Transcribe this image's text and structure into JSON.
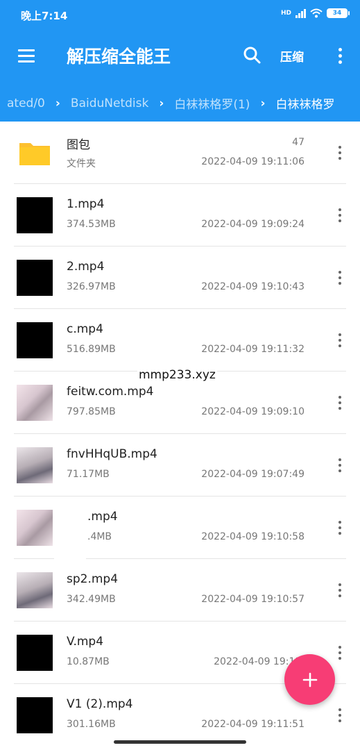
{
  "status_bar": {
    "time": "晚上7:14",
    "network": "HD",
    "battery": "34"
  },
  "toolbar": {
    "title": "解压缩全能王",
    "compress_label": "压缩",
    "menu_icon": "hamburger-menu-icon",
    "search_icon": "search-icon",
    "more_icon": "more-vert-icon"
  },
  "breadcrumb": [
    "ated/0",
    "BaiduNetdisk",
    "白袜袜格罗(1)",
    "白袜袜格罗"
  ],
  "files": [
    {
      "name": "图包",
      "sub": "文件夹",
      "count": "47",
      "date": "2022-04-09 19:11:06",
      "type": "folder"
    },
    {
      "name": "1.mp4",
      "sub": "374.53MB",
      "date": "2022-04-09 19:09:24",
      "type": "video"
    },
    {
      "name": "2.mp4",
      "sub": "326.97MB",
      "date": "2022-04-09 19:10:43",
      "type": "video"
    },
    {
      "name": "c.mp4",
      "sub": "516.89MB",
      "date": "2022-04-09 19:11:32",
      "type": "video"
    },
    {
      "name": "feitw.com.mp4",
      "sub": "797.85MB",
      "date": "2022-04-09 19:09:10",
      "type": "video"
    },
    {
      "name": "fnvHHqUB.mp4",
      "sub": "71.17MB",
      "date": "2022-04-09 19:07:49",
      "type": "video"
    },
    {
      "name": ".mp4",
      "sub": ".4MB",
      "date": "2022-04-09 19:10:58",
      "type": "video"
    },
    {
      "name": "sp2.mp4",
      "sub": "342.49MB",
      "date": "2022-04-09 19:10:57",
      "type": "video"
    },
    {
      "name": "V.mp4",
      "sub": "10.87MB",
      "date": "2022-04-09 19:11:",
      "type": "video"
    },
    {
      "name": "V1 (2).mp4",
      "sub": "301.16MB",
      "date": "2022-04-09 19:11:51",
      "type": "video"
    }
  ],
  "watermark": "mmp233.xyz",
  "fab": {
    "icon": "add-icon"
  },
  "colors": {
    "primary": "#2196F3",
    "accent": "#F73D75",
    "folder": "#FDC02F"
  }
}
